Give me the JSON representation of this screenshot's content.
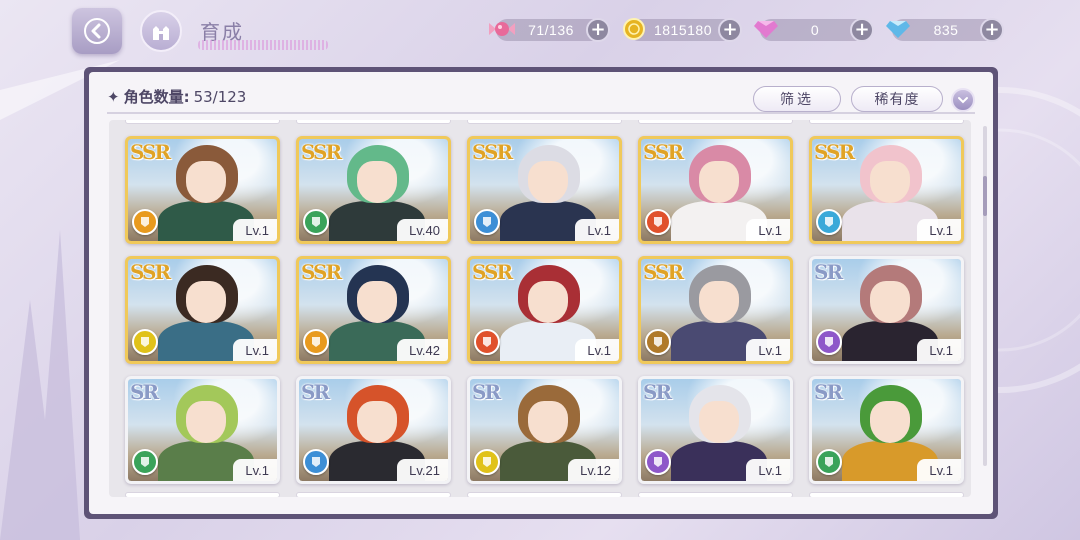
{
  "header": {
    "title": "育成"
  },
  "resources": [
    {
      "name": "candy",
      "value": "71/136",
      "icon": "candy-icon",
      "color": "#e86a9a"
    },
    {
      "name": "gold",
      "value": "1815180",
      "icon": "coin-icon",
      "color": "#e6b422"
    },
    {
      "name": "pink-gem",
      "value": "0",
      "icon": "pink-diamond-icon",
      "color": "#e27ad0"
    },
    {
      "name": "blue-gem",
      "value": "835",
      "icon": "blue-diamond-icon",
      "color": "#5fb8e8"
    }
  ],
  "panel": {
    "count_label": "角色数量:",
    "count_value": "53/123",
    "filter_label": "筛选",
    "sort_label": "稀有度"
  },
  "attr_colors": {
    "orange": "#e89a1e",
    "green": "#3aa35a",
    "blue": "#3d8fd6",
    "red": "#e0512c",
    "purple": "#8e58c9",
    "yellow": "#e0c21a",
    "brown": "#b07a2a",
    "lightblue": "#3aa9d9"
  },
  "cards": [
    {
      "rarity": "SSR",
      "level": "Lv.1",
      "attr": "orange",
      "hair": "#8a5a3a",
      "outfit": "#2f5a48"
    },
    {
      "rarity": "SSR",
      "level": "Lv.40",
      "attr": "green",
      "hair": "#63b98a",
      "outfit": "#2e3a3a"
    },
    {
      "rarity": "SSR",
      "level": "Lv.1",
      "attr": "blue",
      "hair": "#dcdce4",
      "outfit": "#2a3450"
    },
    {
      "rarity": "SSR",
      "level": "Lv.1",
      "attr": "red",
      "hair": "#d98aa6",
      "outfit": "#f3f1f1"
    },
    {
      "rarity": "SSR",
      "level": "Lv.1",
      "attr": "lightblue",
      "hair": "#f1c3cc",
      "outfit": "#e9e2ea"
    },
    {
      "rarity": "SSR",
      "level": "Lv.1",
      "attr": "yellow",
      "hair": "#3b2a22",
      "outfit": "#3a6e86"
    },
    {
      "rarity": "SSR",
      "level": "Lv.42",
      "attr": "orange",
      "hair": "#243452",
      "outfit": "#3a6a58"
    },
    {
      "rarity": "SSR",
      "level": "Lv.1",
      "attr": "red",
      "hair": "#a92f35",
      "outfit": "#e9eef5"
    },
    {
      "rarity": "SSR",
      "level": "Lv.1",
      "attr": "brown",
      "hair": "#9a9aa0",
      "outfit": "#4a4a72"
    },
    {
      "rarity": "SR",
      "level": "Lv.1",
      "attr": "purple",
      "hair": "#b47a7a",
      "outfit": "#2a2430"
    },
    {
      "rarity": "SR",
      "level": "Lv.1",
      "attr": "green",
      "hair": "#a3c85a",
      "outfit": "#5a7e4a"
    },
    {
      "rarity": "SR",
      "level": "Lv.21",
      "attr": "blue",
      "hair": "#d6532a",
      "outfit": "#2a2a30"
    },
    {
      "rarity": "SR",
      "level": "Lv.12",
      "attr": "yellow",
      "hair": "#9a6a3a",
      "outfit": "#4a5a3a"
    },
    {
      "rarity": "SR",
      "level": "Lv.1",
      "attr": "purple",
      "hair": "#e4e4ea",
      "outfit": "#3a305a"
    },
    {
      "rarity": "SR",
      "level": "Lv.1",
      "attr": "green",
      "hair": "#4a9a3a",
      "outfit": "#d89a2a"
    }
  ]
}
